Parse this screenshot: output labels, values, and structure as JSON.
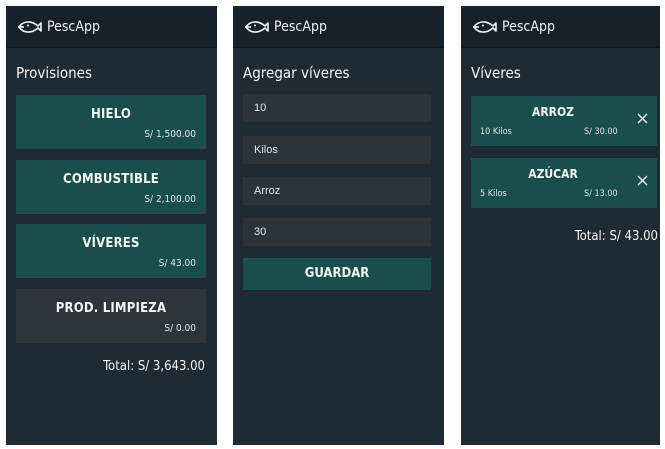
{
  "app": {
    "title": "PescApp"
  },
  "colors": {
    "accent": "#1a4e4c",
    "background": "#1e2a34",
    "inactive": "#2e3439",
    "field": "#2c3339"
  },
  "screen1": {
    "title": "Provisiones",
    "items": [
      {
        "name": "HIELO",
        "amount": "S/ 1,500.00",
        "state": "active"
      },
      {
        "name": "COMBUSTIBLE",
        "amount": "S/ 2,100.00",
        "state": "active"
      },
      {
        "name": "VÍVERES",
        "amount": "S/ 43.00",
        "state": "active"
      },
      {
        "name": "PROD. LIMPIEZA",
        "amount": "S/ 0.00",
        "state": "inactive"
      }
    ],
    "total": "Total: S/ 3,643.00"
  },
  "screen2": {
    "title": "Agregar víveres",
    "fields": {
      "quantity": "10",
      "unit": "Kilos",
      "product": "Arroz",
      "price": "30"
    },
    "save_label": "GUARDAR"
  },
  "screen3": {
    "title": "Víveres",
    "items": [
      {
        "name": "ARROZ",
        "qty": "10 Kilos",
        "price": "S/ 30.00"
      },
      {
        "name": "AZÚCAR",
        "qty": "5 Kilos",
        "price": "S/ 13.00"
      }
    ],
    "total": "Total: S/ 43.00"
  },
  "icons": {
    "logo": "fish-icon",
    "remove": "close-icon"
  }
}
